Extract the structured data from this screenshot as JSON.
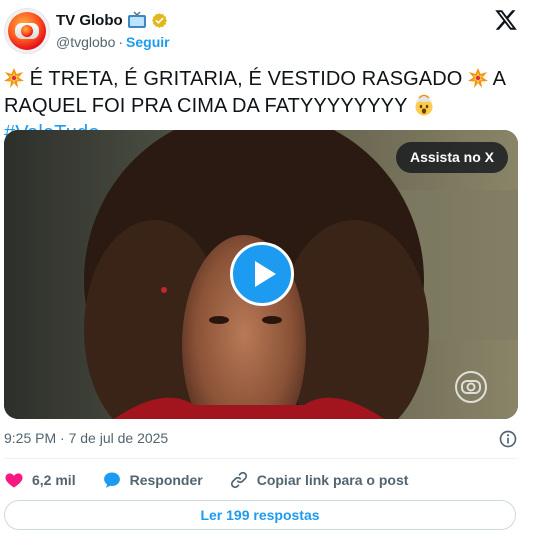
{
  "author": {
    "display_name": "TV Globo",
    "handle": "@tvglobo",
    "separator": "·",
    "follow_label": "Seguir"
  },
  "tweet": {
    "text_part1": "É TRETA, É GRITARIA, É VESTIDO RASGADO ",
    "text_part2": " A RAQUEL FOI PRA CIMA DA FATYYYYYYYY ",
    "hashtag": "#ValeTudo"
  },
  "media": {
    "watch_label": "Assista no X"
  },
  "meta": {
    "timestamp": "9:25 PM · 7 de jul de 2025"
  },
  "actions": {
    "likes": "6,2 mil",
    "reply_label": "Responder",
    "copy_label": "Copiar link para o post"
  },
  "replies_button": "Ler 199 respostas",
  "colors": {
    "accent": "#1d9bf0",
    "like": "#f91880",
    "muted": "#536471",
    "text": "#0f1419"
  },
  "icons": [
    "globo-logo-icon",
    "tv-emoji-icon",
    "verified-badge-icon",
    "x-logo-icon",
    "collision-emoji-icon",
    "exploding-head-emoji-icon",
    "play-icon",
    "globo-watermark-icon",
    "info-icon",
    "heart-icon",
    "reply-bubble-icon",
    "link-icon"
  ]
}
